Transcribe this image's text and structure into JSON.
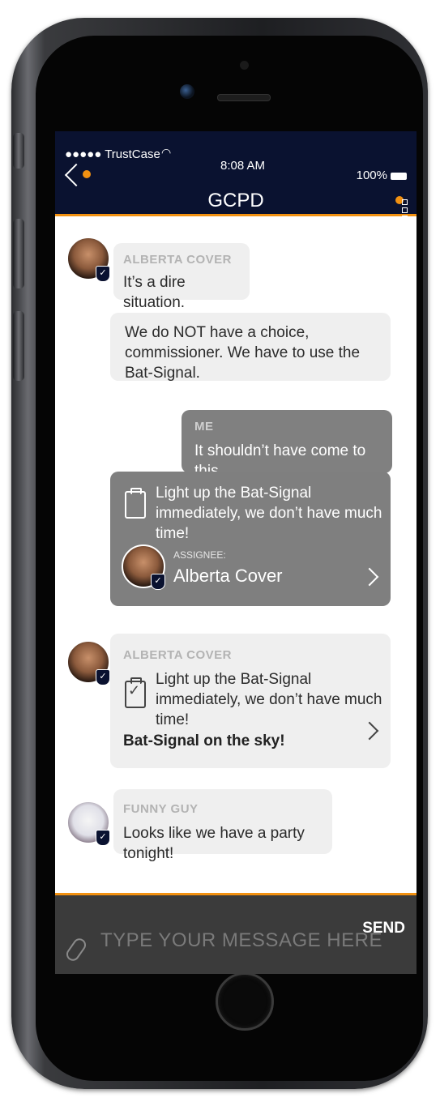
{
  "status_bar": {
    "carrier": "●●●●● TrustCase",
    "time": "8:08 AM",
    "battery": "100%"
  },
  "nav": {
    "title": "GCPD"
  },
  "messages": [
    {
      "sender": "ALBERTA COVER",
      "text": "It’s a dire situation."
    },
    {
      "text": "We do NOT have a choice, commissioner. We have to use the Bat-Signal."
    },
    {
      "sender": "ME",
      "text": "It shouldn’t have come to this..."
    }
  ],
  "task_sent": {
    "text": "Light up the Bat-Signal immediately, we don’t have much time!",
    "assignee_label": "ASSIGNEE:",
    "assignee_name": "Alberta Cover"
  },
  "task_done": {
    "sender": "ALBERTA COVER",
    "text": "Light up the Bat-Signal immediately, we don’t have much time!",
    "result": "Bat-Signal on the sky!"
  },
  "funny": {
    "sender": "FUNNY GUY",
    "text": "Looks like we have a party tonight!"
  },
  "composer": {
    "placeholder": "TYPE YOUR MESSAGE HERE",
    "send_label": "SEND"
  },
  "colors": {
    "navy": "#0a1230",
    "accent": "#f29111",
    "bubble": "#efefef",
    "task": "#7f7f7f"
  }
}
